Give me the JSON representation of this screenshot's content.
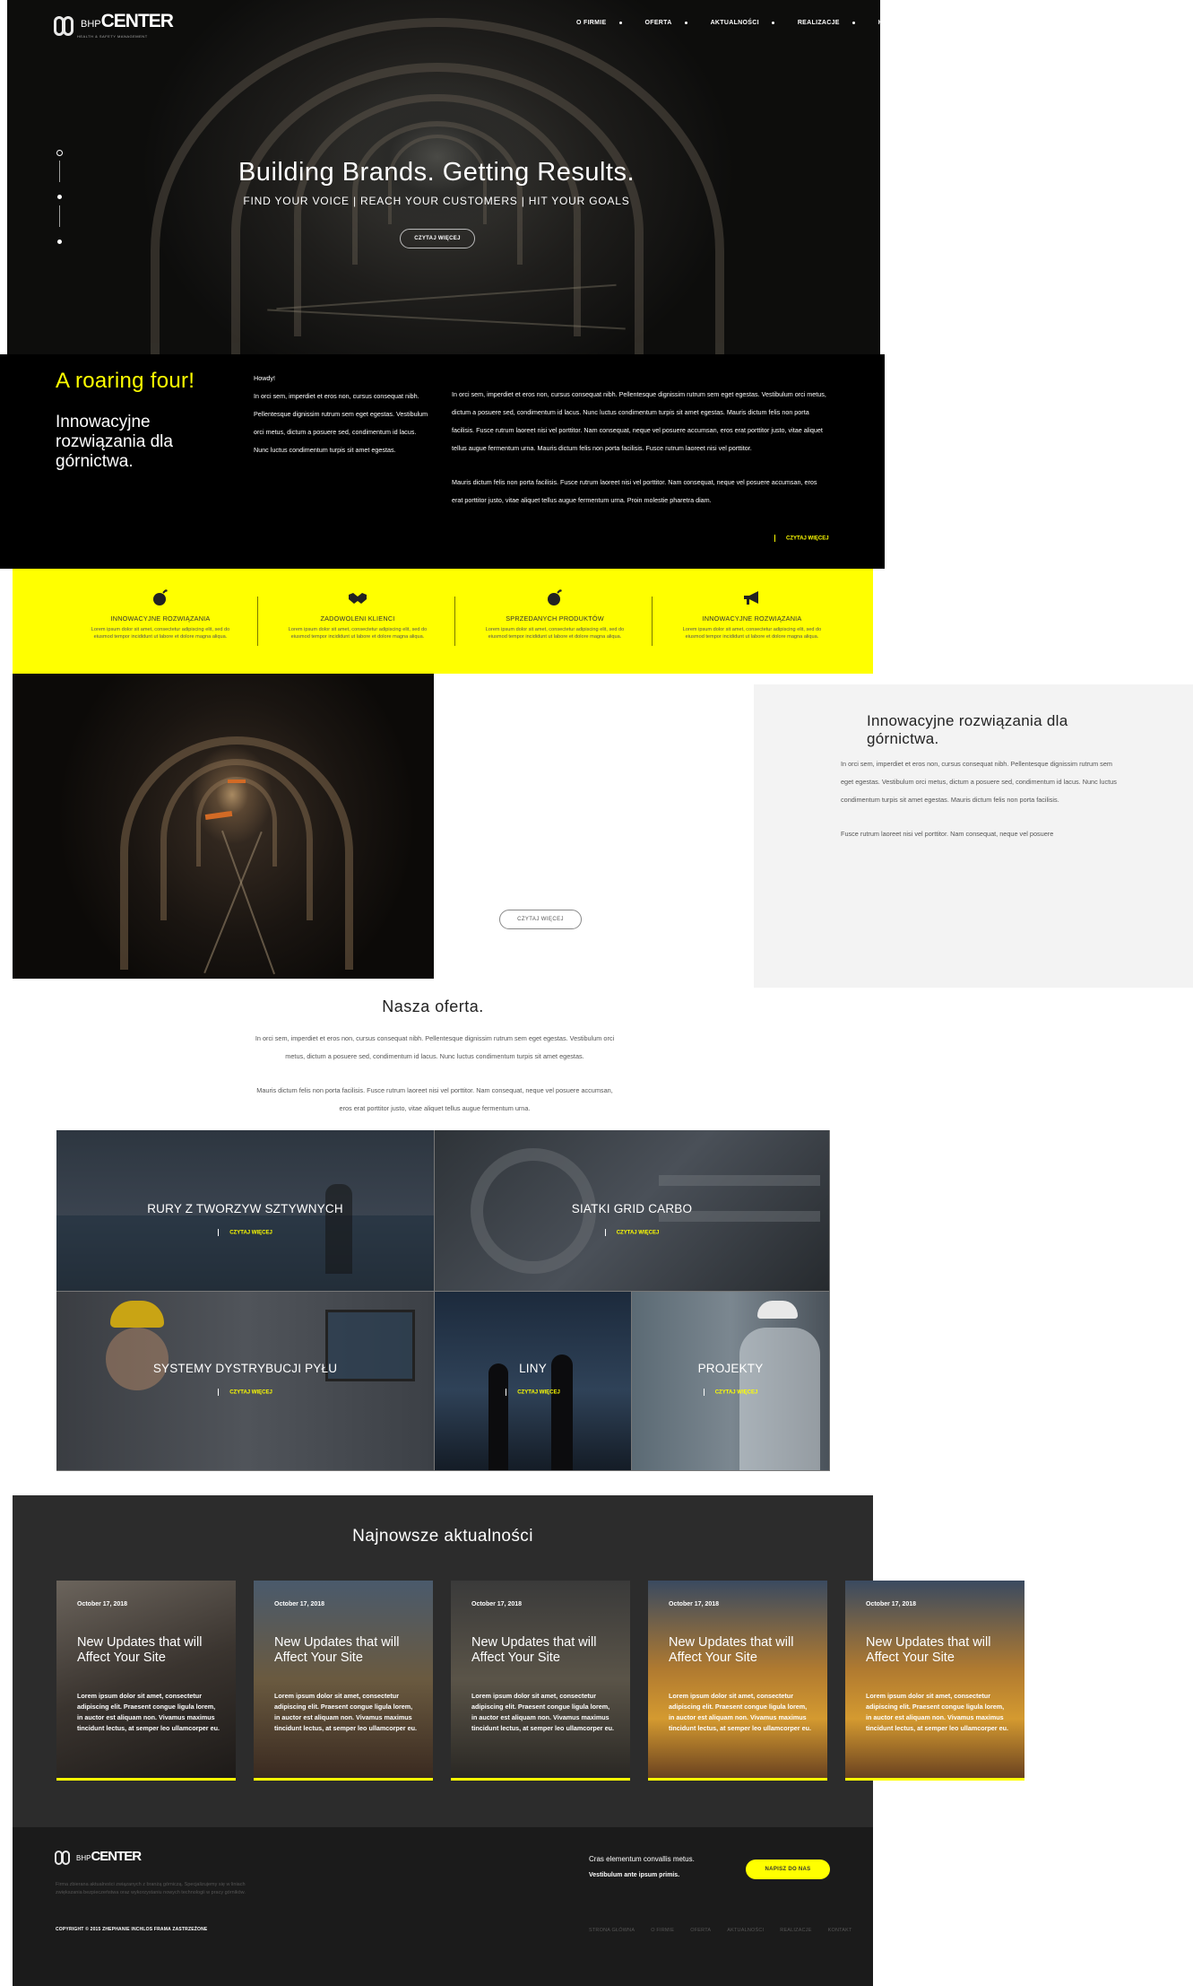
{
  "header": {
    "logo_text": "BHPCENTER",
    "logo_sub": "HEALTH & SAFETY MANAGEMENT",
    "nav": [
      {
        "label": "O FIRMIE",
        "has_dropdown": true
      },
      {
        "label": "OFERTA",
        "has_dropdown": true
      },
      {
        "label": "AKTUALNOŚCI",
        "has_dropdown": true
      },
      {
        "label": "REALIZACJE",
        "has_dropdown": true
      },
      {
        "label": "KONTAKT",
        "has_dropdown": false
      }
    ]
  },
  "hero": {
    "title": "Building Brands. Getting Results.",
    "subtitle": "FIND YOUR VOICE | REACH YOUR CUSTOMERS | HIT YOUR GOALS",
    "button": "CZYTAJ WIĘCEJ"
  },
  "intro": {
    "accent": "A roaring four!",
    "heading": "Innowacyjne rozwiązania dla górnictwa.",
    "col1_greeting": "Howdy!",
    "col1_text": "In orci sem, imperdiet et eros non, cursus consequat nibh. Pellentesque dignissim rutrum sem eget egestas. Vestibulum orci metus, dictum a posuere sed, condimentum id lacus. Nunc luctus condimentum turpis sit amet egestas.",
    "col2_p1": "In orci sem, imperdiet et eros non, cursus consequat nibh. Pellentesque dignissim rutrum sem eget egestas. Vestibulum orci metus, dictum a posuere sed, condimentum id lacus. Nunc luctus condimentum turpis sit amet egestas. Mauris dictum felis non porta facilisis. Fusce rutrum laoreet nisi vel porttitor. Nam consequat, neque vel posuere accumsan, eros erat porttitor justo, vitae aliquet tellus augue fermentum urna. Mauris dictum felis non porta facilisis. Fusce rutrum laoreet nisi vel porttitor.",
    "col2_p2": "Mauris dictum felis non porta facilisis. Fusce rutrum laoreet nisi vel porttitor. Nam consequat, neque vel posuere accumsan, eros erat porttitor justo, vitae aliquet tellus augue fermentum urna. Proin molestie pharetra diam.",
    "more": "CZYTAJ WIĘCEJ"
  },
  "features": [
    {
      "icon": "bomb-icon",
      "title": "INNOWACYJNE ROZWIĄZANIA",
      "text": "Lorem ipsum dolor sit amet, consectetur adipiscing elit, sed do eiusmod tempor incididunt ut labore et dolore magna aliqua."
    },
    {
      "icon": "handshake-icon",
      "title": "ZADOWOLENI KLIENCI",
      "text": "Lorem ipsum dolor sit amet, consectetur adipiscing elit, sed do eiusmod tempor incididunt ut labore et dolore magna aliqua."
    },
    {
      "icon": "bomb-icon",
      "title": "SPRZEDANYCH PRODUKTÓW",
      "text": "Lorem ipsum dolor sit amet, consectetur adipiscing elit, sed do eiusmod tempor incididunt ut labore et dolore magna aliqua."
    },
    {
      "icon": "megaphone-icon",
      "title": "INNOWACYJNE ROZWIĄZANIA",
      "text": "Lorem ipsum dolor sit amet, consectetur adipiscing elit, sed do eiusmod tempor incididunt ut labore et dolore magna aliqua."
    }
  ],
  "mining": {
    "button": "CZYTAJ WIĘCEJ",
    "heading": "Innowacyjne rozwiązania dla górnictwa.",
    "p1": "In orci sem, imperdiet et eros non, cursus consequat nibh. Pellentesque dignissim rutrum sem eget egestas. Vestibulum orci metus, dictum a posuere sed, condimentum id lacus. Nunc luctus condimentum turpis sit amet egestas. Mauris dictum felis non porta facilisis.",
    "p2": "Fusce rutrum laoreet nisi vel porttitor. Nam consequat, neque vel posuere"
  },
  "offer": {
    "title": "Nasza oferta.",
    "p1": "In orci sem, imperdiet et eros non, cursus consequat nibh. Pellentesque dignissim rutrum sem eget egestas. Vestibulum orci metus, dictum a posuere sed, condimentum id lacus. Nunc luctus condimentum turpis sit amet egestas.",
    "p2": "Mauris dictum felis non porta facilisis. Fusce rutrum laoreet nisi vel porttitor. Nam consequat, neque vel posuere accumsan, eros erat porttitor justo, vitae aliquet tellus augue fermentum urna.",
    "tiles": [
      {
        "label": "RURY Z TWORZYW SZTYWNYCH",
        "more": "CZYTAJ WIĘCEJ"
      },
      {
        "label": "SIATKI GRID CARBO",
        "more": "CZYTAJ WIĘCEJ"
      },
      {
        "label": "SYSTEMY DYSTRYBUCJI PYŁU",
        "more": "CZYTAJ WIĘCEJ"
      },
      {
        "label": "LINY",
        "more": "CZYTAJ WIĘCEJ"
      },
      {
        "label": "PROJEKTY",
        "more": "CZYTAJ WIĘCEJ"
      }
    ]
  },
  "news": {
    "title": "Najnowsze aktualności",
    "cards": [
      {
        "date": "October 17, 2018",
        "title": "New Updates that will Affect Your Site",
        "text": "Lorem ipsum dolor sit amet, consectetur adipiscing elit. Praesent congue ligula lorem, in auctor est aliquam non. Vivamus maximus tincidunt lectus, at semper leo ullamcorper eu."
      },
      {
        "date": "October 17, 2018",
        "title": "New Updates that will Affect Your Site",
        "text": "Lorem ipsum dolor sit amet, consectetur adipiscing elit. Praesent congue ligula lorem, in auctor est aliquam non. Vivamus maximus tincidunt lectus, at semper leo ullamcorper eu."
      },
      {
        "date": "October 17, 2018",
        "title": "New Updates that will Affect Your Site",
        "text": "Lorem ipsum dolor sit amet, consectetur adipiscing elit. Praesent congue ligula lorem, in auctor est aliquam non. Vivamus maximus tincidunt lectus, at semper leo ullamcorper eu."
      },
      {
        "date": "October 17, 2018",
        "title": "New Updates that will Affect Your Site",
        "text": "Lorem ipsum dolor sit amet, consectetur adipiscing elit. Praesent congue ligula lorem, in auctor est aliquam non. Vivamus maximus tincidunt lectus, at semper leo ullamcorper eu."
      },
      {
        "date": "October 17, 2018",
        "title": "New Updates that will Affect Your Site",
        "text": "Lorem ipsum dolor sit amet, consectetur adipiscing elit. Praesent congue ligula lorem, in auctor est aliquam non. Vivamus maximus tincidunt lectus, at semper leo ullamcorper eu."
      }
    ]
  },
  "footer": {
    "logo_text": "BHPCENTER",
    "about": "Firma zbierana aktualności związanych z branżą górniczą. Specjalizujemy się w liniach zwiększania bezpieczeństwa oraz wykorzystaniu nowych technologii w pracy górników.",
    "contact_line1": "Cras elementum convallis metus.",
    "contact_line2": "Vestibulum ante ipsum primis.",
    "button": "NAPISZ DO NAS",
    "copyright": "COPYRIGHT © 2015 ZHEPHANIE INCHLOS FRAMA ZASTRZEŻONE",
    "nav": [
      "STRONA GŁÓWNA",
      "O FIRMIE",
      "OFERTA",
      "AKTUALNOŚCI",
      "REALIZACJE",
      "KONTAKT"
    ]
  },
  "colors": {
    "accent": "#ffff00",
    "dark": "#000000",
    "news_bg": "#2c2c2c",
    "footer_bg": "#1b1b1b"
  }
}
